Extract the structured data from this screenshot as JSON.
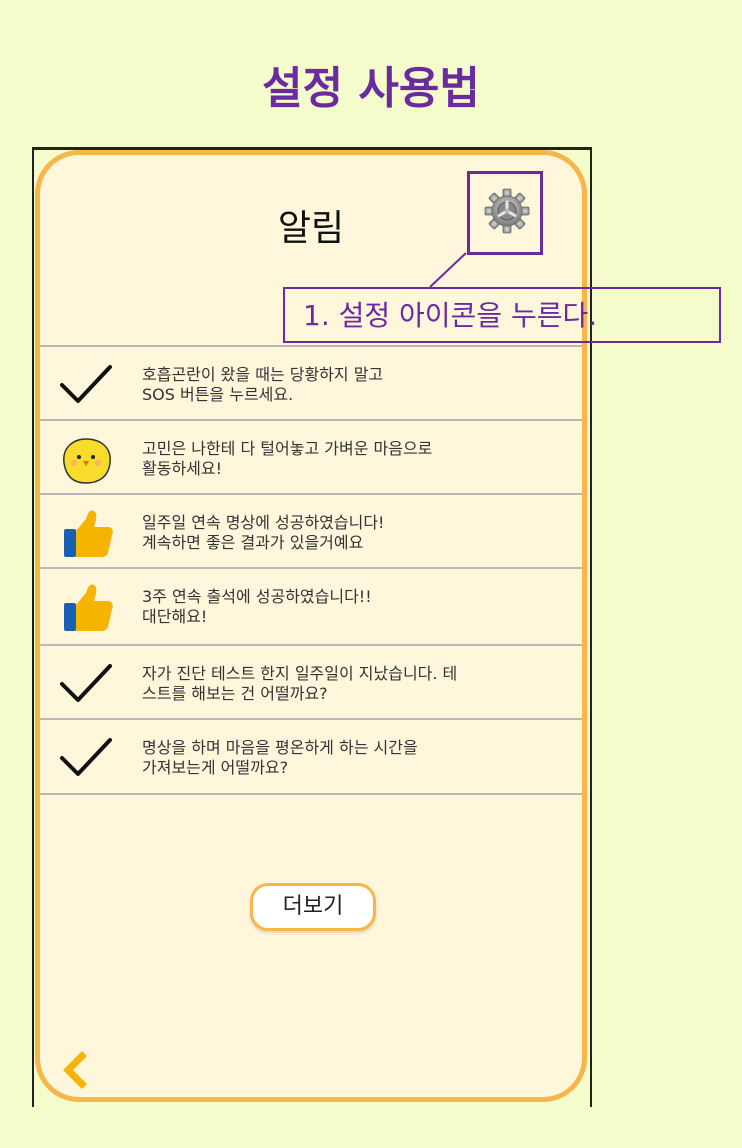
{
  "header": {
    "title": "설정 사용법"
  },
  "screen": {
    "title": "알림",
    "settings_icon": "gear-icon",
    "callout": "1. 설정 아이콘을 누른다.",
    "notifications": [
      {
        "icon": "check-icon",
        "text": "호흡곤란이 왔을 때는 당황하지 말고\nSOS 버튼을 누르세요."
      },
      {
        "icon": "chick-icon",
        "text": "고민은 나한테 다 털어놓고 가벼운 마음으로\n활동하세요!"
      },
      {
        "icon": "thumbs-up-icon",
        "text": "일주일 연속 명상에 성공하였습니다!\n계속하면 좋은 결과가 있을거예요"
      },
      {
        "icon": "thumbs-up-icon",
        "text": "3주 연속 출석에 성공하였습니다!!\n대단해요!"
      },
      {
        "icon": "check-icon",
        "text": "자가 진단 테스트 한지 일주일이 지났습니다. 테\n스트를 해보는 건 어떨까요?"
      },
      {
        "icon": "check-icon",
        "text": "명상을 하며 마음을 평온하게 하는 시간을\n가져보는게 어떨까요?"
      }
    ],
    "more_label": "더보기",
    "back_icon": "chevron-left-icon"
  },
  "colors": {
    "background": "#f4fccb",
    "accent_purple": "#6a2aa0",
    "frame_orange": "#f7b54a",
    "screen_bg": "#fff7dc"
  }
}
